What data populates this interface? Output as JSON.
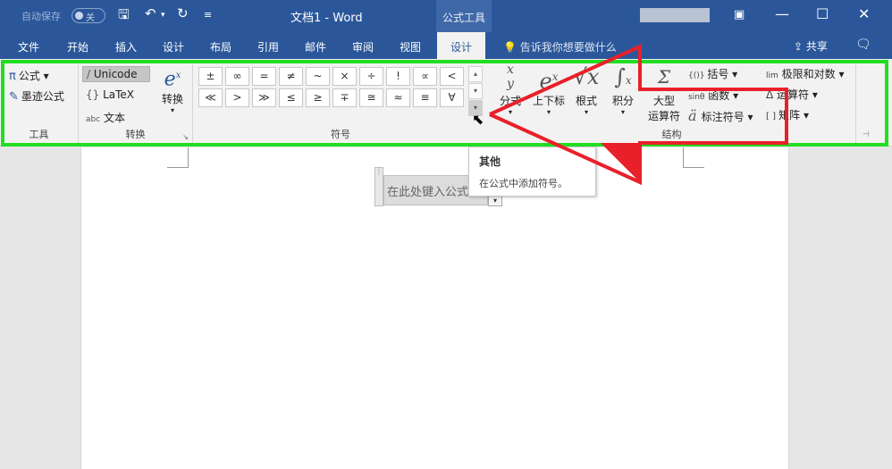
{
  "titlebar": {
    "autosave_label": "自动保存",
    "toggle_text": "关",
    "doc_title": "文档1  -  Word",
    "context_tab": "公式工具"
  },
  "tabs": [
    "文件",
    "开始",
    "插入",
    "设计",
    "布局",
    "引用",
    "邮件",
    "审阅",
    "视图",
    "设计"
  ],
  "active_tab_index": 9,
  "tell_me": "告诉我你想要做什么",
  "share": "共享",
  "ribbon": {
    "tools": {
      "label": "工具",
      "equation": "公式",
      "ink_equation": "墨迹公式"
    },
    "convert": {
      "label": "转换",
      "unicode": "Unicode",
      "latex": "LaTeX",
      "text": "文本",
      "convert_btn": "转换",
      "abc": "abc"
    },
    "symbols": {
      "label": "符号",
      "items": [
        "±",
        "∞",
        "=",
        "≠",
        "~",
        "×",
        "÷",
        "!",
        "∝",
        "<",
        "≪",
        ">",
        "≫",
        "≤",
        "≥",
        "∓",
        "≅",
        "≈",
        "≡",
        "∀"
      ]
    },
    "structures": {
      "label": "结构",
      "fraction": "分式",
      "script": "上下标",
      "radical": "根式",
      "integral": "积分",
      "large_operator_1": "大型",
      "large_operator_2": "运算符",
      "bracket": "括号",
      "function": "函数",
      "function_prefix": "sinθ",
      "accent": "标注符号",
      "limit_log": "极限和对数",
      "limit_prefix": "lim",
      "operator": "运算符",
      "matrix": "矩阵"
    }
  },
  "equation": {
    "placeholder": "在此处键入公式。"
  },
  "tooltip": {
    "title": "其他",
    "description": "在公式中添加符号。"
  },
  "colors": {
    "titlebar": "#2b579a",
    "ribbon": "#f2f2f2",
    "highlight_green": "#22dd22",
    "arrow_red": "#e8202a"
  }
}
